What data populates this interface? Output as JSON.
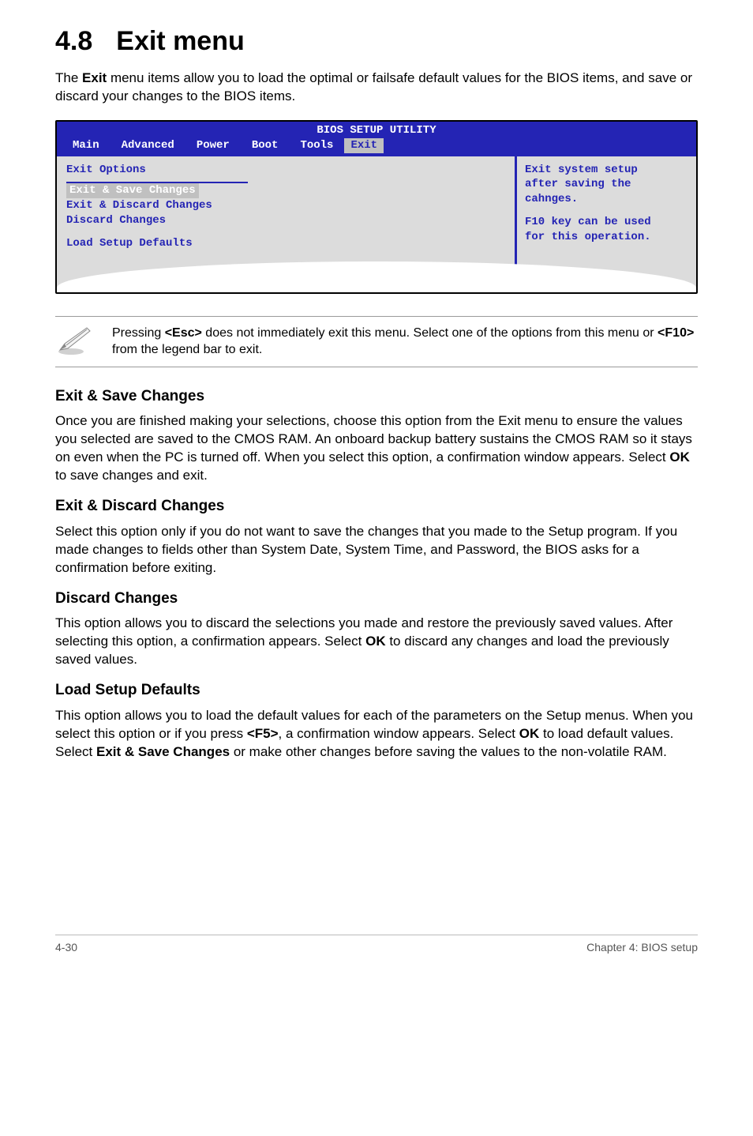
{
  "title": {
    "number": "4.8",
    "text": "Exit menu"
  },
  "intro": {
    "prefix": "The ",
    "bold": "Exit",
    "suffix": " menu items allow you to load the optimal or failsafe default values for the BIOS items, and save or discard your changes to the BIOS items."
  },
  "bios": {
    "utility_title": "BIOS SETUP UTILITY",
    "tabs": [
      "Main",
      "Advanced",
      "Power",
      "Boot",
      "Tools",
      "Exit"
    ],
    "selected_tab": "Exit",
    "left_heading": "Exit Options",
    "items": [
      {
        "label": "Exit & Save Changes",
        "selected": true
      },
      {
        "label": "Exit & Discard Changes",
        "selected": false
      },
      {
        "label": "Discard Changes",
        "selected": false
      }
    ],
    "extra_item": "Load Setup Defaults",
    "help": {
      "l1": "Exit system setup",
      "l2": "after saving the",
      "l3": "cahnges.",
      "l4": "F10 key can be used",
      "l5": "for this operation."
    }
  },
  "note": {
    "p1": "Pressing ",
    "k1": "<Esc>",
    "p2": " does not immediately exit this menu. Select one of the options from this menu or ",
    "k2": "<F10>",
    "p3": " from the legend bar to exit."
  },
  "sections": {
    "s1": {
      "h": "Exit & Save Changes",
      "b_pre": "Once you are finished making your selections, choose this option from the Exit menu to ensure the values you selected are saved to the CMOS RAM. An onboard backup battery sustains the CMOS RAM so it stays on even when the PC is turned off. When you select this option, a confirmation window appears. Select ",
      "b_bold": "OK",
      "b_post": " to save changes and exit."
    },
    "s2": {
      "h": "Exit & Discard Changes",
      "b": "Select this option only if you do not want to save the changes that you made to the Setup program. If you made changes to fields other than System Date, System Time, and Password, the BIOS asks for a confirmation before exiting."
    },
    "s3": {
      "h": "Discard Changes",
      "b_pre": "This option allows you to discard the selections you made and restore the previously saved values. After selecting this option, a confirmation appears. Select ",
      "b_bold": "OK",
      "b_post": " to discard any changes and load the previously saved values."
    },
    "s4": {
      "h": "Load Setup Defaults",
      "b_pre": "This option allows you to load the default values for each of the parameters on the Setup menus. When you select this option or if you press ",
      "b_k1": "<F5>",
      "b_mid1": ", a confirmation window appears. Select ",
      "b_ok": "OK",
      "b_mid2": " to load default values. Select ",
      "b_es": "Exit & Save Changes",
      "b_post": " or make other changes before saving the values to the non-volatile RAM."
    }
  },
  "footer": {
    "left": "4-30",
    "right": "Chapter 4: BIOS setup"
  }
}
